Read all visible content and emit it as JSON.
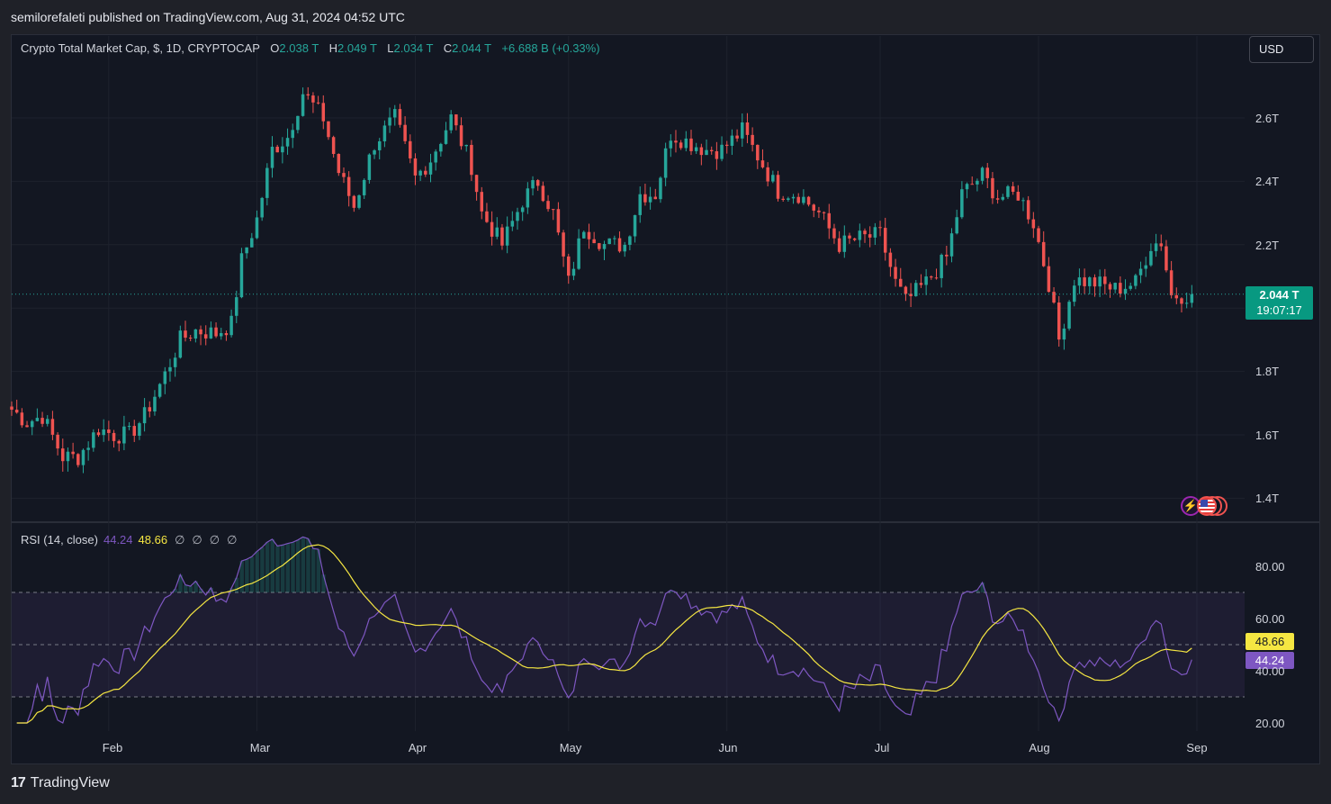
{
  "header": {
    "publisher_text": "semilorefaleti published on TradingView.com, Aug 31, 2024 04:52 UTC"
  },
  "legend": {
    "symbol": "Crypto Total Market Cap, $, 1D, CRYPTOCAP",
    "open_label": "O",
    "open": "2.038 T",
    "high_label": "H",
    "high": "2.049 T",
    "low_label": "L",
    "low": "2.034 T",
    "close_label": "C",
    "close": "2.044 T",
    "change": "+6.688 B (+0.33%)"
  },
  "currency_button": "USD",
  "price_tag": {
    "price": "2.044 T",
    "countdown": "19:07:17"
  },
  "rsi_legend": {
    "label": "RSI (14, close)",
    "rsi_value": "44.24",
    "ma_value": "48.66",
    "nulls": [
      "∅",
      "∅",
      "∅",
      "∅"
    ]
  },
  "rsi_tags": {
    "ma": "48.66",
    "rsi": "44.24"
  },
  "price_axis": [
    "2.6T",
    "2.4T",
    "2.2T",
    "1.8T",
    "1.6T",
    "1.4T"
  ],
  "rsi_axis": [
    "80.00",
    "60.00",
    "40.00",
    "20.00"
  ],
  "time_axis": [
    "Feb",
    "Mar",
    "Apr",
    "May",
    "Jun",
    "Jul",
    "Aug",
    "Sep"
  ],
  "footer": {
    "logo": "17",
    "brand": "TradingView"
  },
  "colors": {
    "up": "#26a69a",
    "down": "#ef5350",
    "rsi": "#7e57c2",
    "rsi_ma": "#f5e642",
    "background": "#131722"
  },
  "icons": [
    "tradingview-logo-icon",
    "us-flag-event-icon",
    "lightning-event-icon"
  ],
  "chart_data": {
    "type": "candlestick",
    "title": "Crypto Total Market Cap, $, 1D, CRYPTOCAP",
    "unit": "T USD",
    "ylim": [
      1.35,
      2.78
    ],
    "x_range": [
      "2024-01-13",
      "2024-08-31"
    ],
    "current_price": 2.044,
    "anchors": [
      [
        "2024-01-13",
        1.68
      ],
      [
        "2024-01-16",
        1.64
      ],
      [
        "2024-01-19",
        1.66
      ],
      [
        "2024-01-23",
        1.53
      ],
      [
        "2024-01-26",
        1.53
      ],
      [
        "2024-01-30",
        1.62
      ],
      [
        "2024-02-02",
        1.6
      ],
      [
        "2024-02-05",
        1.6
      ],
      [
        "2024-02-08",
        1.66
      ],
      [
        "2024-02-12",
        1.79
      ],
      [
        "2024-02-15",
        1.9
      ],
      [
        "2024-02-18",
        1.93
      ],
      [
        "2024-02-22",
        1.92
      ],
      [
        "2024-02-25",
        1.95
      ],
      [
        "2024-02-27",
        2.15
      ],
      [
        "2024-03-01",
        2.28
      ],
      [
        "2024-03-04",
        2.5
      ],
      [
        "2024-03-07",
        2.54
      ],
      [
        "2024-03-10",
        2.68
      ],
      [
        "2024-03-14",
        2.6
      ],
      [
        "2024-03-17",
        2.43
      ],
      [
        "2024-03-20",
        2.32
      ],
      [
        "2024-03-24",
        2.52
      ],
      [
        "2024-03-28",
        2.6
      ],
      [
        "2024-04-01",
        2.41
      ],
      [
        "2024-04-04",
        2.47
      ],
      [
        "2024-04-08",
        2.6
      ],
      [
        "2024-04-12",
        2.45
      ],
      [
        "2024-04-14",
        2.3
      ],
      [
        "2024-04-18",
        2.2
      ],
      [
        "2024-04-22",
        2.34
      ],
      [
        "2024-04-25",
        2.4
      ],
      [
        "2024-04-28",
        2.3
      ],
      [
        "2024-05-01",
        2.08
      ],
      [
        "2024-05-04",
        2.26
      ],
      [
        "2024-05-08",
        2.2
      ],
      [
        "2024-05-12",
        2.2
      ],
      [
        "2024-05-15",
        2.36
      ],
      [
        "2024-05-18",
        2.36
      ],
      [
        "2024-05-21",
        2.55
      ],
      [
        "2024-05-25",
        2.52
      ],
      [
        "2024-05-28",
        2.5
      ],
      [
        "2024-05-31",
        2.5
      ],
      [
        "2024-06-04",
        2.56
      ],
      [
        "2024-06-07",
        2.48
      ],
      [
        "2024-06-11",
        2.37
      ],
      [
        "2024-06-15",
        2.36
      ],
      [
        "2024-06-19",
        2.3
      ],
      [
        "2024-06-23",
        2.2
      ],
      [
        "2024-06-27",
        2.22
      ],
      [
        "2024-07-01",
        2.23
      ],
      [
        "2024-07-04",
        2.08
      ],
      [
        "2024-07-06",
        2.02
      ],
      [
        "2024-07-10",
        2.08
      ],
      [
        "2024-07-14",
        2.16
      ],
      [
        "2024-07-17",
        2.36
      ],
      [
        "2024-07-21",
        2.42
      ],
      [
        "2024-07-24",
        2.35
      ],
      [
        "2024-07-28",
        2.36
      ],
      [
        "2024-07-31",
        2.27
      ],
      [
        "2024-08-03",
        2.08
      ],
      [
        "2024-08-05",
        1.9
      ],
      [
        "2024-08-08",
        2.09
      ],
      [
        "2024-08-12",
        2.08
      ],
      [
        "2024-08-16",
        2.06
      ],
      [
        "2024-08-20",
        2.08
      ],
      [
        "2024-08-23",
        2.2
      ],
      [
        "2024-08-25",
        2.21
      ],
      [
        "2024-08-27",
        2.04
      ],
      [
        "2024-08-31",
        2.044
      ]
    ],
    "rsi": {
      "period": 14,
      "value": 44.24,
      "ma_value": 48.66,
      "ylim": [
        15,
        95
      ],
      "upper_band": 70,
      "middle_band": 50,
      "lower_band": 30
    }
  }
}
